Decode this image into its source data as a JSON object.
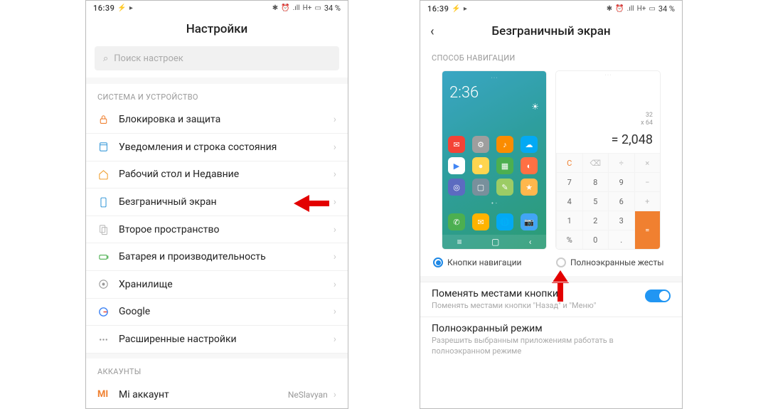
{
  "status": {
    "time": "16:39",
    "battery": "34 %",
    "net": "H+"
  },
  "phone1": {
    "title": "Настройки",
    "search_placeholder": "Поиск настроек",
    "section1": "СИСТЕМА И УСТРОЙСТВО",
    "rows": [
      "Блокировка и защита",
      "Уведомления и строка состояния",
      "Рабочий стол и Недавние",
      "Безграничный экран",
      "Второе пространство",
      "Батарея и производительность",
      "Хранилище",
      "Google",
      "Расширенные настройки"
    ],
    "section2": "АККАУНТЫ",
    "account_row": "Mi аккаунт",
    "account_value": "NeSlavyan"
  },
  "phone2": {
    "title": "Безграничный экран",
    "section": "СПОСОБ НАВИГАЦИИ",
    "radio1": "Кнопки навигации",
    "radio2": "Полноэкранные жесты",
    "swap_title": "Поменять местами кнопки",
    "swap_sub": "Поменять местами кнопки \"Назад\" и \"Меню\"",
    "full_title": "Полноэкранный режим",
    "full_sub": "Разрешить выбранным приложениям работать в полноэкранном режиме",
    "preview_clock": "2:36",
    "calc": {
      "e1": "32",
      "e2": "x 64",
      "result": "= 2,048"
    }
  }
}
